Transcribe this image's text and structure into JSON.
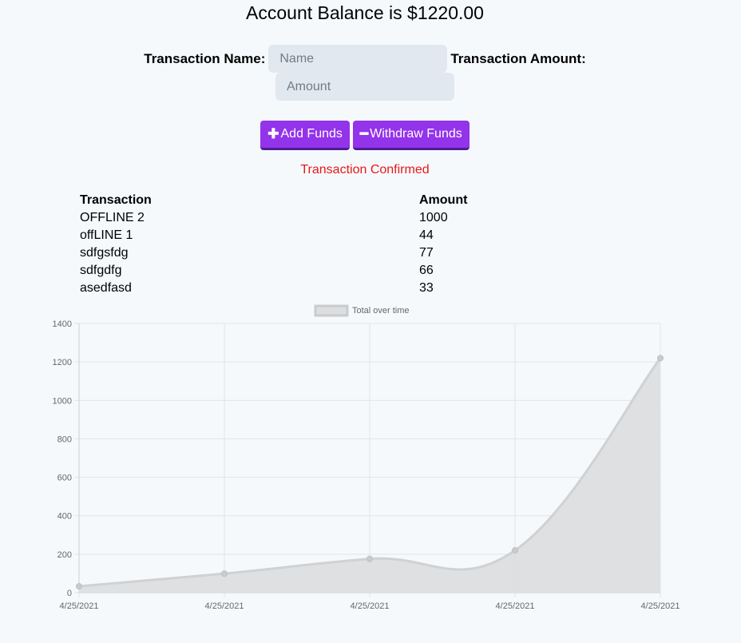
{
  "header": {
    "title": "Account Balance is $1220.00"
  },
  "form": {
    "name_label": "Transaction Name:",
    "name_placeholder": "Name",
    "amount_label": "Transaction Amount:",
    "amount_placeholder": "Amount"
  },
  "buttons": {
    "add_icon": "plus-icon",
    "add_label": "Add Funds",
    "withdraw_icon": "minus-icon",
    "withdraw_label": "Withdraw Funds",
    "color": "#9333ea"
  },
  "status": {
    "text": "Transaction Confirmed",
    "color": "#e61919"
  },
  "table": {
    "headers": [
      "Transaction",
      "Amount"
    ],
    "rows": [
      [
        "OFFLINE 2",
        "1000"
      ],
      [
        "offLINE 1",
        "44"
      ],
      [
        "sdfgsfdg",
        "77"
      ],
      [
        "sdfgdfg",
        "66"
      ],
      [
        "asedfasd",
        "33"
      ]
    ]
  },
  "chart_data": {
    "type": "area",
    "legend": "Total over time",
    "legend_position": "top-center",
    "x": [
      "4/25/2021",
      "4/25/2021",
      "4/25/2021",
      "4/25/2021",
      "4/25/2021"
    ],
    "series": [
      {
        "name": "Total over time",
        "values": [
          33,
          99,
          176,
          220,
          1220
        ]
      }
    ],
    "ylim": [
      0,
      1400
    ],
    "yticks": [
      0,
      200,
      400,
      600,
      800,
      1000,
      1200,
      1400
    ],
    "grid": true,
    "colors": {
      "fill": "#dcdedf",
      "line": "#cfd1d3"
    }
  }
}
